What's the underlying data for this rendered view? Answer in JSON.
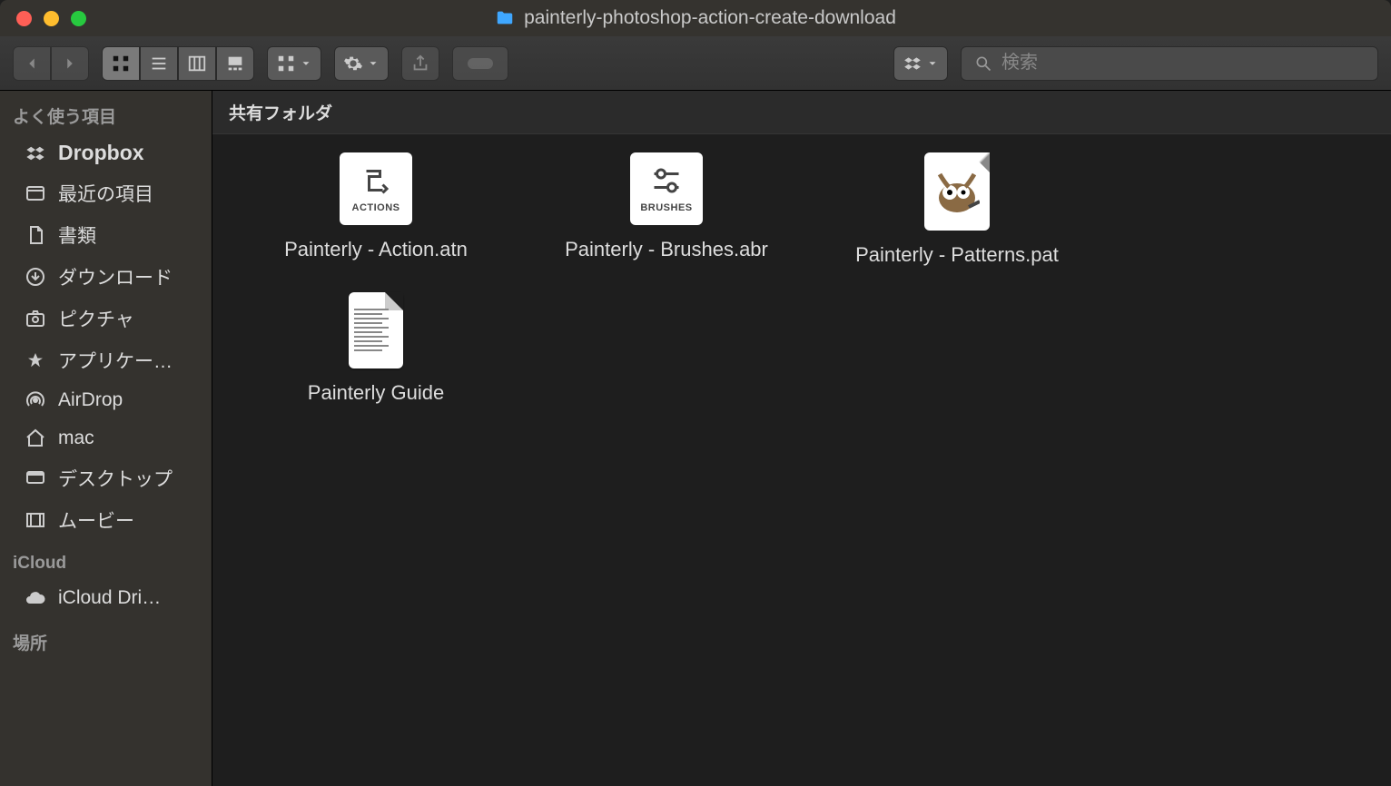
{
  "window": {
    "title": "painterly-photoshop-action-create-download"
  },
  "search": {
    "placeholder": "検索"
  },
  "sidebar": {
    "sections": [
      {
        "label": "よく使う項目",
        "items": [
          {
            "icon": "dropbox-icon",
            "label": "Dropbox",
            "bold": true
          },
          {
            "icon": "recent-icon",
            "label": "最近の項目"
          },
          {
            "icon": "documents-icon",
            "label": "書類"
          },
          {
            "icon": "downloads-icon",
            "label": "ダウンロード"
          },
          {
            "icon": "camera-icon",
            "label": "ピクチャ"
          },
          {
            "icon": "apps-icon",
            "label": "アプリケー…"
          },
          {
            "icon": "airdrop-icon",
            "label": "AirDrop"
          },
          {
            "icon": "home-icon",
            "label": "mac"
          },
          {
            "icon": "desktop-icon",
            "label": "デスクトップ"
          },
          {
            "icon": "movies-icon",
            "label": "ムービー"
          }
        ]
      },
      {
        "label": "iCloud",
        "items": [
          {
            "icon": "cloud-icon",
            "label": "iCloud Dri…"
          }
        ]
      },
      {
        "label": "場所",
        "items": []
      }
    ]
  },
  "main": {
    "header": "共有フォルダ",
    "files": [
      {
        "kind": "atn",
        "label": "Painterly - Action.atn",
        "badge": "ACTIONS"
      },
      {
        "kind": "abr",
        "label": "Painterly - Brushes.abr",
        "badge": "BRUSHES"
      },
      {
        "kind": "pat",
        "label": "Painterly - Patterns.pat"
      },
      {
        "kind": "doc",
        "label": "Painterly Guide"
      }
    ]
  }
}
